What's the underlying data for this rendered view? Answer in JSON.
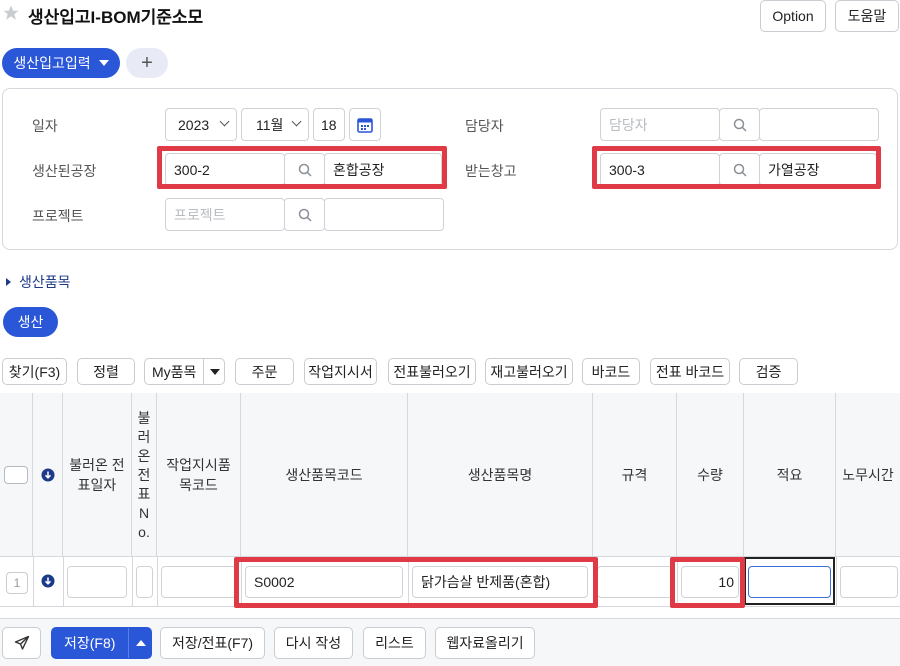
{
  "page": {
    "title": "생산입고I-BOM기준소모",
    "option_label": "Option",
    "help_label": "도움말"
  },
  "tabs": {
    "active_label": "생산입고입력",
    "add_label": "+"
  },
  "form": {
    "date_label": "일자",
    "year": "2023",
    "month": "11월",
    "day": "18",
    "manager_label": "담당자",
    "manager_placeholder": "담당자",
    "factory_label": "생산된공장",
    "factory_code": "300-2",
    "factory_name": "혼합공장",
    "warehouse_label": "받는창고",
    "warehouse_code": "300-3",
    "warehouse_name": "가열공장",
    "project_label": "프로젝트",
    "project_placeholder": "프로젝트"
  },
  "section": {
    "items_label": "생산품목",
    "production_tab": "생산"
  },
  "toolbar": {
    "find": "찾기(F3)",
    "sort": "정렬",
    "my_items": "My품목",
    "order": "주문",
    "work_order": "작업지시서",
    "load_slip": "전표불러오기",
    "load_stock": "재고불러오기",
    "barcode": "바코드",
    "slip_barcode": "전표 바코드",
    "verify": "검증"
  },
  "table": {
    "headers": {
      "loaded_date": "불러온 전표일자",
      "loaded_no": "불러온전표No.",
      "work_item_code": "작업지시품목코드",
      "item_code": "생산품목코드",
      "item_name": "생산품목명",
      "spec": "규격",
      "qty": "수량",
      "memo": "적요",
      "labor_time": "노무시간"
    },
    "rows": [
      {
        "no": "1",
        "item_code": "S0002",
        "item_name": "닭가슴살 반제품(혼합)",
        "qty": "10"
      }
    ]
  },
  "footer": {
    "save": "저장(F8)",
    "save_slip": "저장/전표(F7)",
    "rewrite": "다시 작성",
    "list": "리스트",
    "upload": "웹자료올리기"
  },
  "colors": {
    "accent": "#2a56d8",
    "highlight": "#e03a47"
  }
}
